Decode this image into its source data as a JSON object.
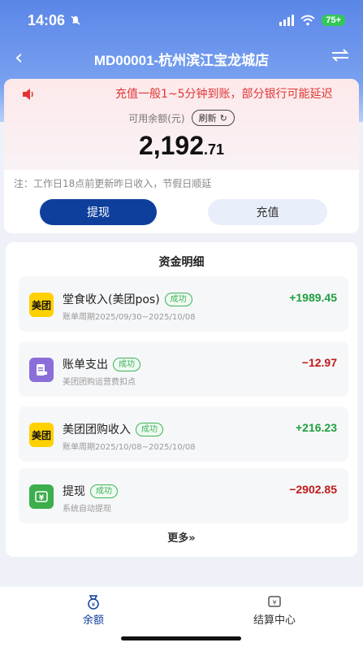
{
  "status_bar": {
    "time": "14:06",
    "battery": "75+"
  },
  "nav": {
    "title": "MD00001-杭州滨江宝龙城店"
  },
  "balance": {
    "notice": "充值一般1~5分钟到账，部分银行可能延迟",
    "available_label": "可用余额(元)",
    "refresh_label": "刷新",
    "amount_int": "2,192",
    "amount_dec": ".71",
    "note": "注：工作日18点前更新昨日收入，节假日顺延",
    "withdraw_label": "提现",
    "recharge_label": "充值"
  },
  "ledger": {
    "title": "资金明细",
    "items": [
      {
        "icon": "meituan-icon",
        "icon_text": "美团",
        "name": "堂食收入(美团pos)",
        "status": "成功",
        "sub": "账单周期2025/09/30~2025/10/08",
        "amount": "+1989.45",
        "color": "#1f9f3e"
      },
      {
        "icon": "bill-icon",
        "icon_text": "",
        "name": "账单支出",
        "status": "成功",
        "sub": "美团团购运营费扣点",
        "amount": "−12.97",
        "color": "#c01a1a"
      },
      {
        "icon": "meituan-icon",
        "icon_text": "美团",
        "name": "美团团购收入",
        "status": "成功",
        "sub": "账单周期2025/10/08~2025/10/08",
        "amount": "+216.23",
        "color": "#1f9f3e"
      },
      {
        "icon": "withdraw-icon",
        "icon_text": "",
        "name": "提现",
        "status": "成功",
        "sub": "系统自动提现",
        "amount": "−2902.85",
        "color": "#c01a1a"
      }
    ],
    "more_label": "更多»"
  },
  "tabs": [
    {
      "label": "余额",
      "active": true
    },
    {
      "label": "结算中心",
      "active": false
    }
  ],
  "colors": {
    "accent": "#0f3f9c",
    "header": "#5a86e8",
    "success": "#3cb35a",
    "meituan": "#ffd100"
  }
}
